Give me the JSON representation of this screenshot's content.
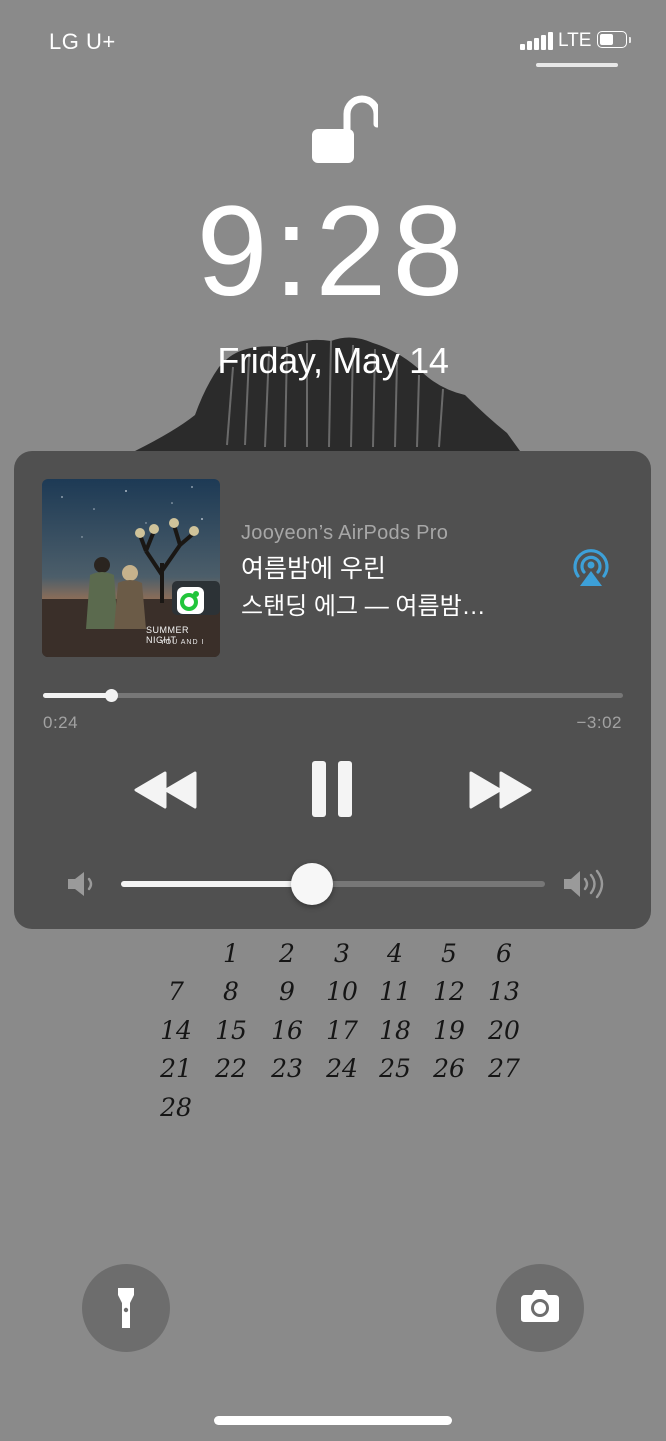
{
  "status_bar": {
    "carrier": "LG U+",
    "network": "LTE",
    "battery_level": 0.55
  },
  "lock_screen": {
    "time": "9:28",
    "date": "Friday, May 14"
  },
  "now_playing": {
    "device": "Jooyeon’s AirPods Pro",
    "title": "여름밤에 우린",
    "artist": "스탠딩 에그 — 여름밤…",
    "artwork_text": [
      "SUMMER NIGHT",
      "YOU AND I"
    ],
    "elapsed": "0:24",
    "remaining": "−3:02",
    "progress": 0.117,
    "volume": 0.45,
    "accent_color": "#3da0d8",
    "app_badge_color": "#21c53b",
    "icons": {
      "rewind": "rewind-icon",
      "pause": "pause-icon",
      "forward": "fast-forward-icon",
      "airplay": "airplay-audio-icon",
      "volume_low": "speaker-low-icon",
      "volume_high": "speaker-high-icon"
    }
  },
  "calendar": {
    "weeks": [
      [
        "",
        "1",
        "2",
        "3",
        "4",
        "5",
        "6"
      ],
      [
        "7",
        "8",
        "9",
        "10",
        "11",
        "12",
        "13"
      ],
      [
        "14",
        "15",
        "16",
        "17",
        "18",
        "19",
        "20"
      ],
      [
        "21",
        "22",
        "23",
        "24",
        "25",
        "26",
        "27"
      ],
      [
        "28",
        "",
        "",
        "",
        "",
        "",
        ""
      ]
    ]
  },
  "quick_actions": {
    "flashlight_icon": "flashlight-icon",
    "camera_icon": "camera-icon"
  }
}
